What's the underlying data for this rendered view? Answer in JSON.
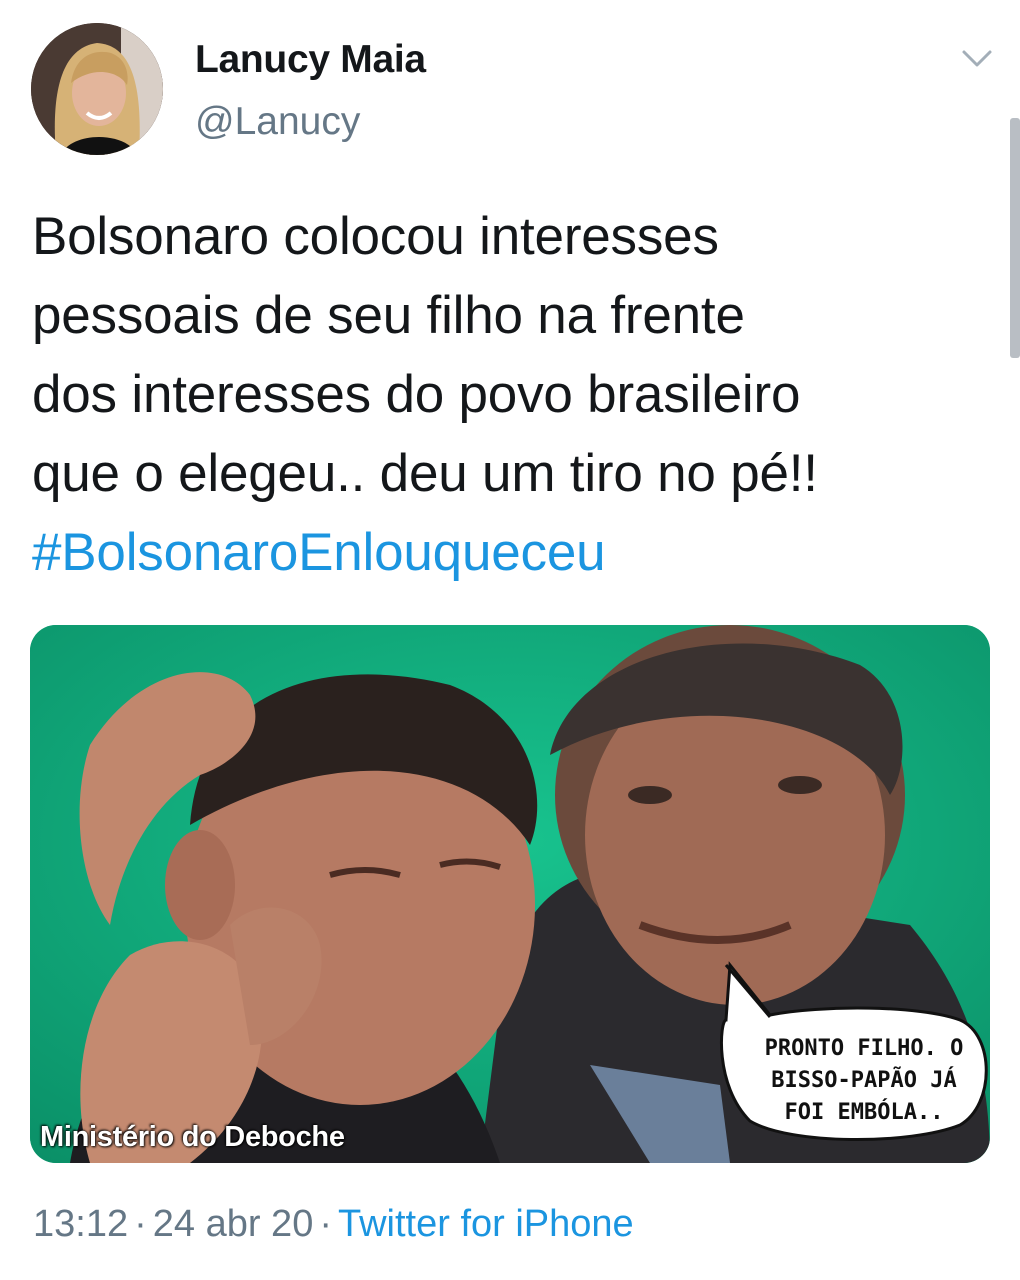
{
  "author": {
    "display_name": "Lanucy Maia",
    "handle": "@Lanucy",
    "avatar_icon": "profile-photo"
  },
  "tweet": {
    "text_lines": [
      "Bolsonaro colocou interesses",
      "pessoais de seu filho na frente",
      "dos interesses do povo brasileiro",
      "que o elegeu.. deu um tiro no pé!!"
    ],
    "hashtag": "#BolsonaroEnlouqueceu"
  },
  "media": {
    "watermark": "Ministério do Deboche",
    "speech_lines": [
      "PRONTO FILHO. O",
      "BISSO-PAPÃO JÁ",
      "FOI EMBÓLA.."
    ],
    "background_color": "#11a87a"
  },
  "meta": {
    "time": "13:12",
    "date": "24 abr 20",
    "separator": "·",
    "source": "Twitter for iPhone"
  },
  "colors": {
    "text": "#14171a",
    "muted": "#657786",
    "link": "#1b95e0"
  },
  "icons": {
    "menu": "chevron-down-icon"
  }
}
